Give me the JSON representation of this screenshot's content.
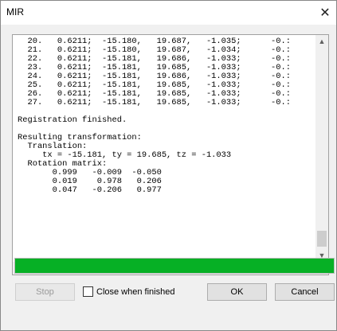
{
  "window": {
    "title": "MIR",
    "close_glyph": "✕"
  },
  "log": {
    "lines": [
      "  20.   0.6211;  -15.180,   19.687,   -1.035;      -0.:",
      "  21.   0.6211;  -15.180,   19.687,   -1.034;      -0.:",
      "  22.   0.6211;  -15.181,   19.686,   -1.033;      -0.:",
      "  23.   0.6211;  -15.181,   19.685,   -1.033;      -0.:",
      "  24.   0.6211;  -15.181,   19.686,   -1.033;      -0.:",
      "  25.   0.6211;  -15.181,   19.685,   -1.033;      -0.:",
      "  26.   0.6211;  -15.181,   19.685,   -1.033;      -0.:",
      "  27.   0.6211;  -15.181,   19.685,   -1.033;      -0.:",
      "",
      "Registration finished.",
      "",
      "Resulting transformation:",
      "  Translation:",
      "     tx = -15.181, ty = 19.685, tz = -1.033",
      "  Rotation matrix:",
      "       0.999   -0.009  -0.050",
      "       0.019    0.978   0.206",
      "       0.047   -0.206   0.977"
    ]
  },
  "scrollbars": {
    "up_icon": "up-arrow-icon",
    "down_icon": "down-arrow-icon",
    "left_icon": "left-arrow-icon",
    "right_icon": "right-arrow-icon"
  },
  "progress": {
    "value_fraction": 1.0,
    "color": "#06b025"
  },
  "buttons": {
    "stop_label": "Stop",
    "ok_label": "OK",
    "cancel_label": "Cancel"
  },
  "options": {
    "close_when_finished_label": "Close when finished",
    "close_when_finished_checked": false
  }
}
